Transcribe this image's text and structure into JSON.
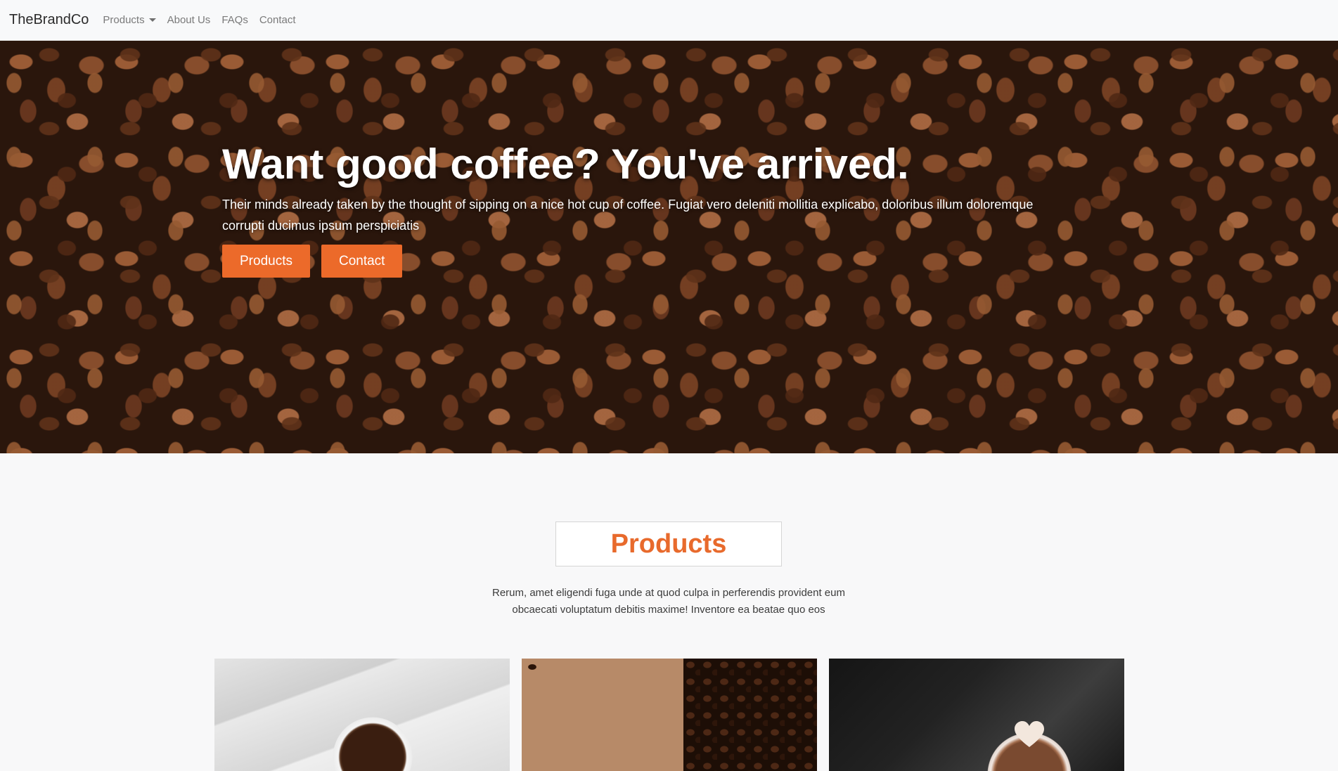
{
  "navbar": {
    "brand": "TheBrandCo",
    "items": [
      {
        "label": "Products",
        "dropdown": true
      },
      {
        "label": "About Us"
      },
      {
        "label": "FAQs"
      },
      {
        "label": "Contact"
      }
    ]
  },
  "hero": {
    "title": "Want good coffee? You've arrived.",
    "subtitle": "Their minds already taken by the thought of sipping on a nice hot cup of coffee. Fugiat vero deleniti mollitia explicabo, doloribus illum doloremque corrupti ducimus ipsum perspiciatis",
    "buttons": {
      "products_label": "Products",
      "contact_label": "Contact"
    }
  },
  "products_section": {
    "title": "Products",
    "description": "Rerum, amet eligendi fuga unde at quod culpa in perferendis provident eum obcaecati voluptatum debitis maxime! Inventore ea beatae quo eos"
  },
  "colors": {
    "accent": "#ec6a2a",
    "title_accent": "#e86a2c",
    "navbar_bg": "#f8f9fa",
    "page_bg": "#f8f8f9"
  }
}
